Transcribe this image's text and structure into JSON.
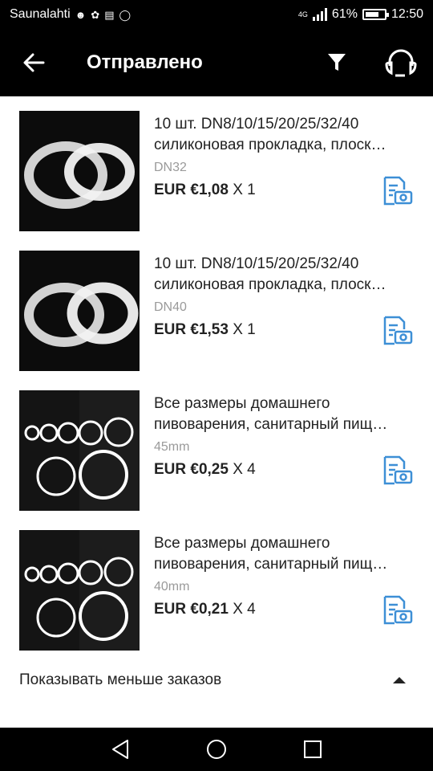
{
  "status_bar": {
    "carrier": "Saunalahti",
    "network": "4G",
    "battery_percent": "61%",
    "time": "12:50"
  },
  "app_bar": {
    "title": "Отправлено",
    "back_icon": "arrow-left-icon",
    "filter_icon": "filter-icon",
    "support_icon": "headset-icon"
  },
  "orders": [
    {
      "title_line1": "10 шт. DN8/10/15/20/25/32/40",
      "title_line2": "силиконовая прокладка, плоск…",
      "variant": "DN32",
      "price": "EUR €1,08",
      "quantity": "X 1",
      "thumb": "clear-rings"
    },
    {
      "title_line1": "10 шт. DN8/10/15/20/25/32/40",
      "title_line2": "силиконовая прокладка, плоск…",
      "variant": "DN40",
      "price": "EUR €1,53",
      "quantity": "X 1",
      "thumb": "clear-rings"
    },
    {
      "title_line1": "Все размеры домашнего",
      "title_line2": "пивоварения, санитарный пищ…",
      "variant": "45mm",
      "price": "EUR €0,25",
      "quantity": "X 4",
      "thumb": "white-orings"
    },
    {
      "title_line1": "Все размеры домашнего",
      "title_line2": "пивоварения, санитарный пищ…",
      "variant": "40mm",
      "price": "EUR €0,21",
      "quantity": "X 4",
      "thumb": "white-orings"
    }
  ],
  "show_less_label": "Показывать меньше заказов",
  "colors": {
    "accent": "#3d8fd6",
    "bar": "#000000"
  }
}
